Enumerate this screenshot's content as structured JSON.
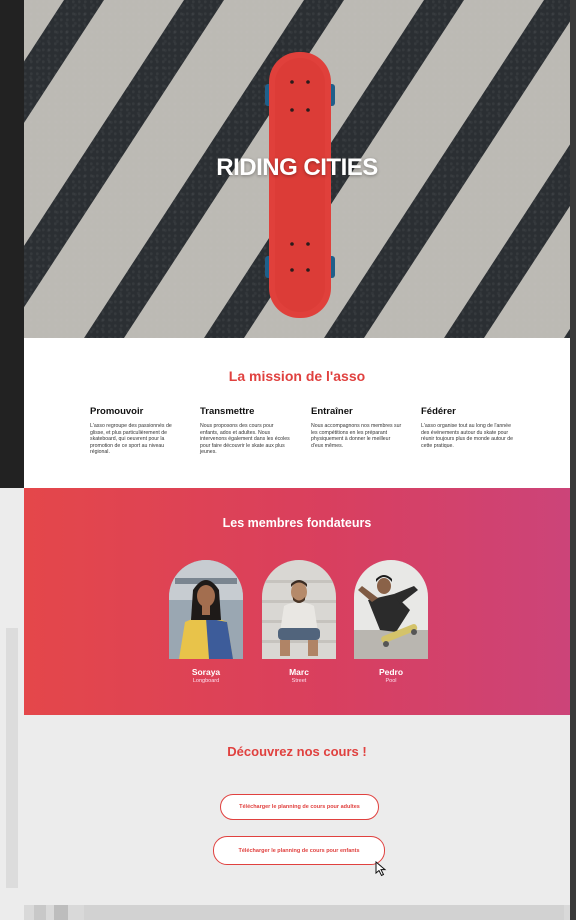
{
  "hero": {
    "title": "RIDING CITIES"
  },
  "mission": {
    "title": "La mission de l'asso",
    "columns": [
      {
        "heading": "Promouvoir",
        "text": "L'asso regroupe des passionnés de glisse, et plus particulièrement de skateboard, qui oeuvrent pour la promotion de ce sport au niveau régional."
      },
      {
        "heading": "Transmettre",
        "text": "Nous proposons des cours pour enfants, ados et adultes. Nous intervenons également dans les écoles pour faire découvrir le skate aux plus jeunes."
      },
      {
        "heading": "Entraîner",
        "text": "Nous accompagnons nos membres sur les compétitions en les préparant physiquement à donner le meilleur d'eux mêmes."
      },
      {
        "heading": "Fédérer",
        "text": "L'asso organise tout au long de l'année des événements autour du skate pour réunir toujours plus de monde autour de cette pratique."
      }
    ]
  },
  "founders": {
    "title": "Les membres fondateurs",
    "members": [
      {
        "name": "Soraya",
        "role": "Longboard"
      },
      {
        "name": "Marc",
        "role": "Street"
      },
      {
        "name": "Pedro",
        "role": "Pool"
      }
    ]
  },
  "courses": {
    "title": "Découvrez nos cours !",
    "adults_button": "Télécharger le planning de cours pour adultes",
    "kids_button": "Télécharger le planning de cours pour enfants"
  },
  "colors": {
    "accent": "#e0413f",
    "gradient_start": "#e4474a",
    "gradient_end": "#cc4479",
    "skateboard": "#e0403b"
  }
}
